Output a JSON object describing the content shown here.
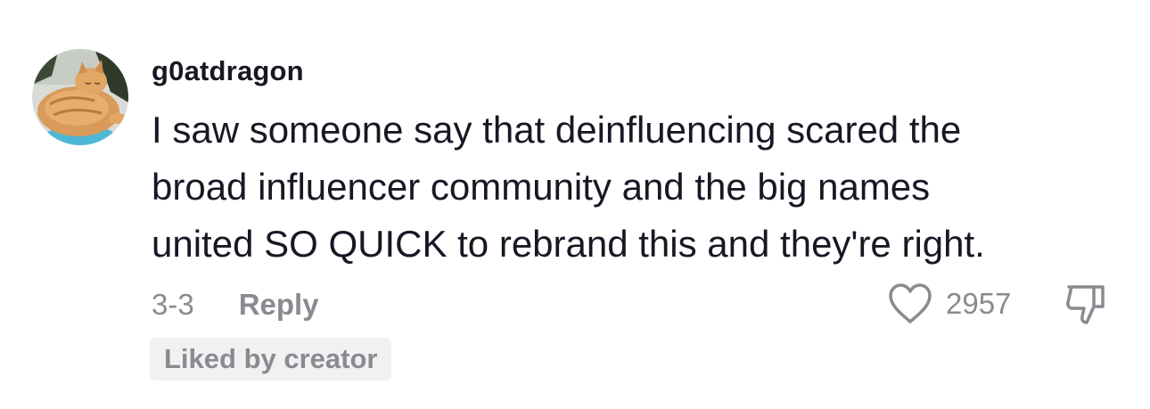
{
  "comment": {
    "username": "g0atdragon",
    "text_lines": [
      "I saw someone say that deinfluencing scared the",
      "broad influencer community and the big names",
      "united SO QUICK to rebrand this and they're right."
    ],
    "date": "3-3",
    "reply_label": "Reply",
    "like_count": "2957",
    "liked_by_creator_label": "Liked by creator"
  },
  "icons": {
    "like": "heart-outline-icon",
    "dislike": "thumbs-down-icon",
    "avatar": "orange-cat-photo"
  },
  "colors": {
    "text_primary": "#161823",
    "text_secondary": "#8a8b91",
    "badge_bg": "#f1f1f2"
  }
}
